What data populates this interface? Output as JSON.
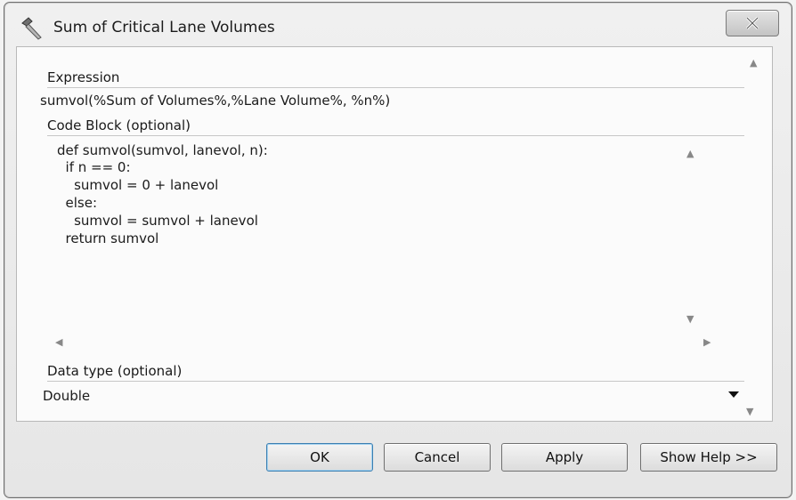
{
  "window": {
    "title": "Sum of Critical Lane Volumes",
    "app_icon": "hammer-icon",
    "close_icon": "close-icon"
  },
  "expression": {
    "label": "Expression",
    "value": "sumvol(%Sum of Volumes%,%Lane Volume%, %n%)"
  },
  "code_block": {
    "label": "Code Block (optional)",
    "lines": [
      "def sumvol(sumvol, lanevol, n):",
      "  if n == 0:",
      "    sumvol = 0 + lanevol",
      "  else:",
      "    sumvol = sumvol + lanevol",
      "  return sumvol"
    ]
  },
  "data_type": {
    "label": "Data type (optional)",
    "value": "Double"
  },
  "buttons": {
    "ok": "OK",
    "cancel": "Cancel",
    "apply": "Apply",
    "show_help": "Show Help >>"
  }
}
